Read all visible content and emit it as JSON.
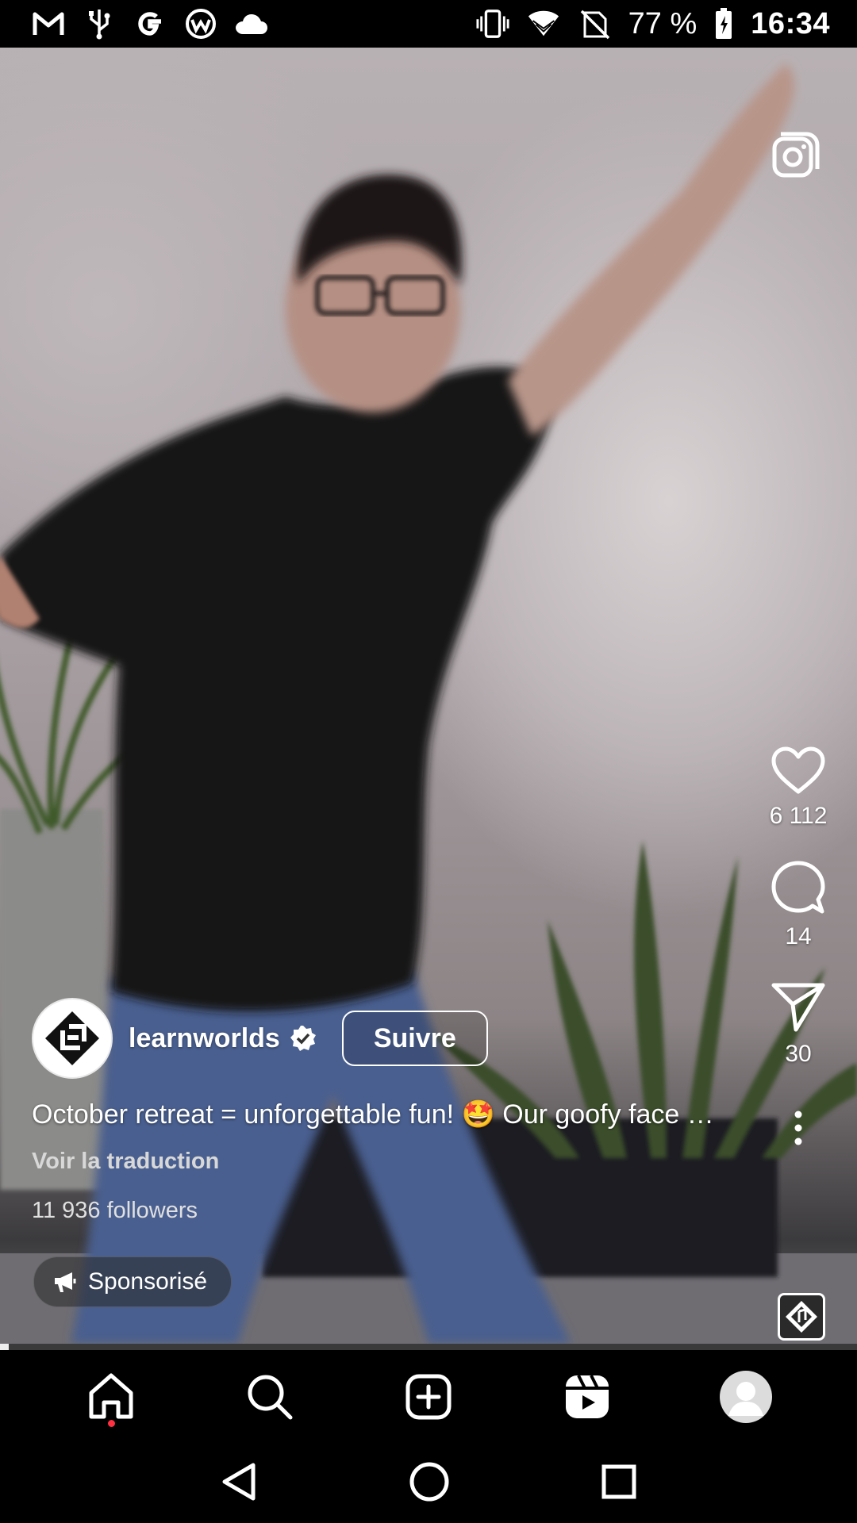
{
  "status_bar": {
    "battery_percent": "77 %",
    "time": "16:34",
    "left_icons": [
      "gmail-icon",
      "usb-icon",
      "google-icon",
      "wm-icon",
      "cloud-icon"
    ],
    "right_icons": [
      "vibrate-icon",
      "wifi-icon",
      "no-sim-icon",
      "battery-icon"
    ]
  },
  "reel": {
    "likes": "6 112",
    "comments": "14",
    "shares": "30",
    "account": {
      "username": "learnworlds",
      "verified": true,
      "follow_label": "Suivre"
    },
    "caption": "October retreat = unforgettable fun! 🤩 Our goofy face …",
    "translate_label": "Voir la traduction",
    "followers": "11 936 followers",
    "sponsored_label": "Sponsorisé",
    "progress": 0.01
  },
  "bottom_nav": {
    "items": [
      "home-icon",
      "search-icon",
      "create-icon",
      "reels-icon",
      "profile-icon"
    ],
    "home_has_notification": true
  },
  "system_nav": [
    "back-icon",
    "home-circle-icon",
    "recents-icon"
  ],
  "colors": {
    "notification": "#ff3040",
    "background": "#000000",
    "text": "#ffffff"
  }
}
